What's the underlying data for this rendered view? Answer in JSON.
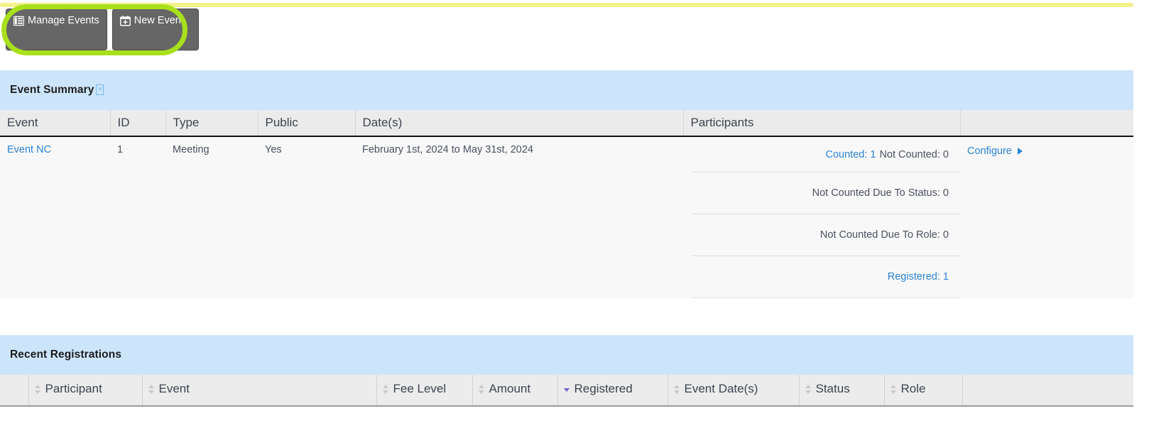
{
  "toolbar": {
    "buttons": [
      {
        "label": "Manage Events",
        "icon": "list-table-icon"
      },
      {
        "label": "New Event",
        "icon": "calendar-plus-icon"
      }
    ]
  },
  "annotation": {
    "shape": "ellipse-highlight",
    "color": "#a8e01b",
    "target": "toolbar-buttons"
  },
  "top_rule_color": "#f4f08a",
  "event_summary": {
    "title": "Event Summary",
    "title_glyph": "missing-glyph-box",
    "columns": [
      "Event",
      "ID",
      "Type",
      "Public",
      "Date(s)",
      "Participants",
      ""
    ],
    "rows": [
      {
        "event": "Event NC",
        "id": "1",
        "type": "Meeting",
        "public": "Yes",
        "dates": "February 1st, 2024 to May 31st, 2024",
        "participants": [
          {
            "counted_label": "Counted: 1",
            "not_counted_label": "Not Counted: 0"
          },
          {
            "label": "Not Counted Due To Status: 0"
          },
          {
            "label": "Not Counted Due To Role: 0"
          },
          {
            "label": "Registered: 1"
          }
        ],
        "configure_label": "Configure"
      }
    ]
  },
  "recent_registrations": {
    "title": "Recent Registrations",
    "columns": [
      {
        "label": "Participant",
        "sort": "none"
      },
      {
        "label": "Event",
        "sort": "none"
      },
      {
        "label": "Fee Level",
        "sort": "none"
      },
      {
        "label": "Amount",
        "sort": "none"
      },
      {
        "label": "Registered",
        "sort": "desc"
      },
      {
        "label": "Event Date(s)",
        "sort": "none"
      },
      {
        "label": "Status",
        "sort": "none"
      },
      {
        "label": "Role",
        "sort": "none"
      }
    ]
  },
  "colors": {
    "panel_header_bg": "#cde5fb",
    "table_header_bg": "#ebebeb",
    "link": "#2b83d4",
    "button_bg": "#666666",
    "highlight": "#a8e01b",
    "active_sort": "#6b64d8"
  }
}
